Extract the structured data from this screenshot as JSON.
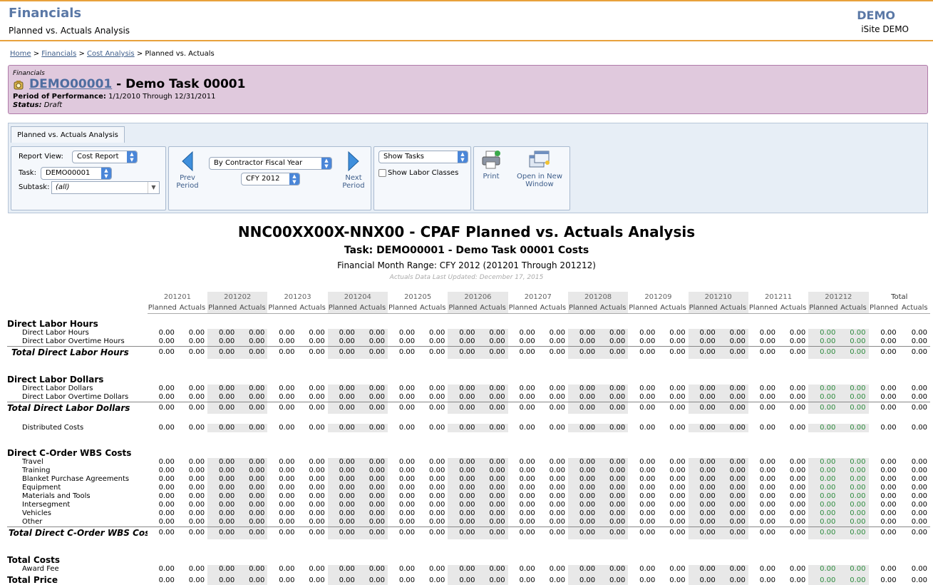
{
  "header": {
    "app_title": "Financials",
    "page_subtitle": "Planned vs. Actuals Analysis",
    "org_name": "DEMO",
    "org_sub": "iSite DEMO"
  },
  "breadcrumb": {
    "home": "Home",
    "financials": "Financials",
    "cost_analysis": "Cost Analysis",
    "current": "Planned vs. Actuals"
  },
  "record": {
    "category": "Financials",
    "task_id": "DEMO00001",
    "task_name": " - Demo Task 00001",
    "pop_label": "Period of Performance:",
    "pop_value": "1/1/2010 Through 12/31/2011",
    "status_label": "Status:",
    "status_value": "Draft"
  },
  "toolbar": {
    "tab_label": "Planned vs. Actuals Analysis",
    "report_view_label": "Report View:",
    "report_view_value": "Cost Report",
    "task_label": "Task:",
    "task_value": "DEMO00001",
    "subtask_label": "Subtask:",
    "subtask_value": "(all)",
    "prev_label_1": "Prev",
    "prev_label_2": "Period",
    "next_label_1": "Next",
    "next_label_2": "Period",
    "period_type": "By Contractor Fiscal Year",
    "period_value": "CFY 2012",
    "show_tasks": "Show Tasks",
    "show_labor_classes": "Show Labor Classes",
    "print_label": "Print",
    "open_new_1": "Open in New",
    "open_new_2": "Window"
  },
  "report": {
    "title": "NNC00XX00X-NNX00 - CPAF Planned vs. Actuals Analysis",
    "task_line": "Task: DEMO00001 - Demo Task 00001 Costs",
    "range_line": "Financial Month Range: CFY 2012 (201201 Through 201212)",
    "updated_line": "Actuals Data Last Updated: December 17, 2015",
    "months": [
      "201201",
      "201202",
      "201203",
      "201204",
      "201205",
      "201206",
      "201207",
      "201208",
      "201209",
      "201210",
      "201211",
      "201212"
    ],
    "total_header": "Total",
    "planned_label": "Planned",
    "actuals_label": "Actuals",
    "zero": "0.00",
    "rows": [
      {
        "type": "section",
        "label": "Direct Labor Hours"
      },
      {
        "type": "item",
        "label": "Direct Labor Hours"
      },
      {
        "type": "item",
        "label": "Direct Labor Overtime Hours"
      },
      {
        "type": "total",
        "label": "Total Direct Labor Hours"
      },
      {
        "type": "gap"
      },
      {
        "type": "section",
        "label": "Direct Labor Dollars"
      },
      {
        "type": "item",
        "label": "Direct Labor Dollars"
      },
      {
        "type": "item",
        "label": "Direct Labor Overtime Dollars"
      },
      {
        "type": "total",
        "label": "Total Direct Labor Dollars"
      },
      {
        "type": "gap"
      },
      {
        "type": "item",
        "label": "Distributed Costs"
      },
      {
        "type": "gap"
      },
      {
        "type": "section",
        "label": "Direct C-Order WBS Costs"
      },
      {
        "type": "item",
        "label": "Travel"
      },
      {
        "type": "item",
        "label": "Training"
      },
      {
        "type": "item",
        "label": "Blanket Purchase Agreements"
      },
      {
        "type": "item",
        "label": "Equipment"
      },
      {
        "type": "item",
        "label": "Materials and Tools"
      },
      {
        "type": "item",
        "label": "Intersegment"
      },
      {
        "type": "item",
        "label": "Vehicles"
      },
      {
        "type": "item",
        "label": "Other"
      },
      {
        "type": "totalleft",
        "label": "Total Direct C-Order WBS Costs"
      },
      {
        "type": "gap"
      },
      {
        "type": "section",
        "label": "Total Costs"
      },
      {
        "type": "item",
        "label": "Award Fee"
      },
      {
        "type": "sectionval",
        "label": "Total Price"
      }
    ]
  },
  "colors": {
    "accent_orange": "#e8a13c",
    "title_blue": "#5a78a6",
    "record_bg": "#e0c9dd",
    "current_month_green": "#2e8b3e"
  }
}
